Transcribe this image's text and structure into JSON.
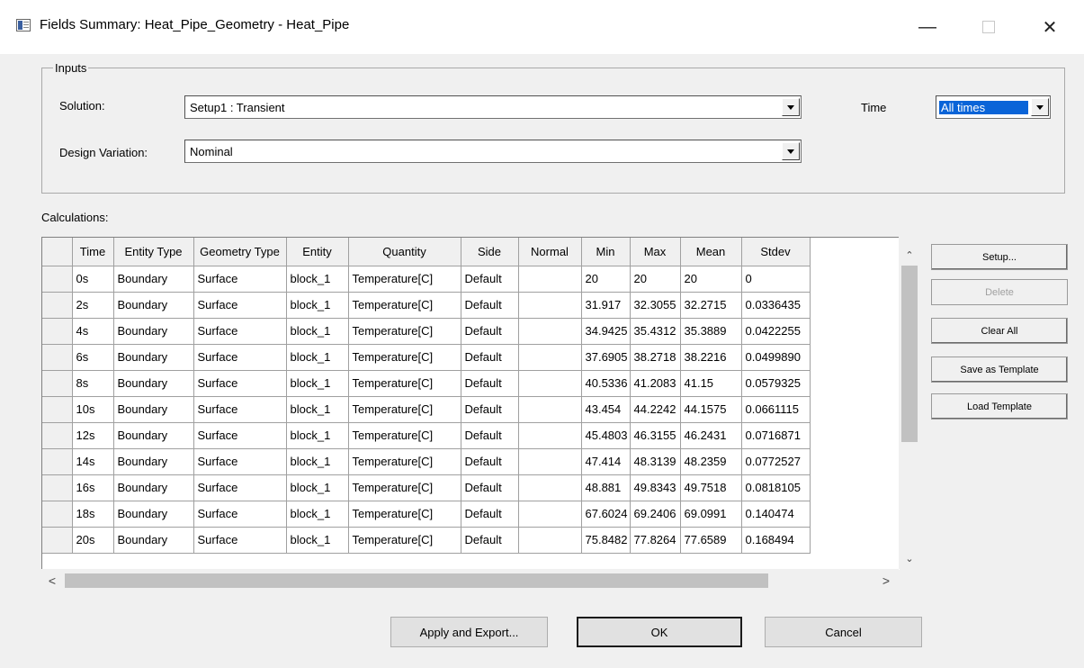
{
  "window": {
    "title": "Fields Summary: Heat_Pipe_Geometry - Heat_Pipe",
    "minimize_glyph": "—",
    "close_glyph": "✕"
  },
  "inputs": {
    "legend": "Inputs",
    "solution_label": "Solution:",
    "solution_value": "Setup1 : Transient",
    "design_variation_label": "Design Variation:",
    "design_variation_value": "Nominal",
    "time_label": "Time",
    "time_value": "All times"
  },
  "calculations": {
    "label": "Calculations:",
    "columns": [
      "Time",
      "Entity Type",
      "Geometry Type",
      "Entity",
      "Quantity",
      "Side",
      "Normal",
      "Min",
      "Max",
      "Mean",
      "Stdev"
    ],
    "rows": [
      [
        "0s",
        "Boundary",
        "Surface",
        "block_1",
        "Temperature[C]",
        "Default",
        "",
        "20",
        "20",
        "20",
        "0"
      ],
      [
        "2s",
        "Boundary",
        "Surface",
        "block_1",
        "Temperature[C]",
        "Default",
        "",
        "31.917",
        "32.3055",
        "32.2715",
        "0.0336435"
      ],
      [
        "4s",
        "Boundary",
        "Surface",
        "block_1",
        "Temperature[C]",
        "Default",
        "",
        "34.9425",
        "35.4312",
        "35.3889",
        "0.0422255"
      ],
      [
        "6s",
        "Boundary",
        "Surface",
        "block_1",
        "Temperature[C]",
        "Default",
        "",
        "37.6905",
        "38.2718",
        "38.2216",
        "0.0499890"
      ],
      [
        "8s",
        "Boundary",
        "Surface",
        "block_1",
        "Temperature[C]",
        "Default",
        "",
        "40.5336",
        "41.2083",
        "41.15",
        "0.0579325"
      ],
      [
        "10s",
        "Boundary",
        "Surface",
        "block_1",
        "Temperature[C]",
        "Default",
        "",
        "43.454",
        "44.2242",
        "44.1575",
        "0.0661115"
      ],
      [
        "12s",
        "Boundary",
        "Surface",
        "block_1",
        "Temperature[C]",
        "Default",
        "",
        "45.4803",
        "46.3155",
        "46.2431",
        "0.0716871"
      ],
      [
        "14s",
        "Boundary",
        "Surface",
        "block_1",
        "Temperature[C]",
        "Default",
        "",
        "47.414",
        "48.3139",
        "48.2359",
        "0.0772527"
      ],
      [
        "16s",
        "Boundary",
        "Surface",
        "block_1",
        "Temperature[C]",
        "Default",
        "",
        "48.881",
        "49.8343",
        "49.7518",
        "0.0818105"
      ],
      [
        "18s",
        "Boundary",
        "Surface",
        "block_1",
        "Temperature[C]",
        "Default",
        "",
        "67.6024",
        "69.2406",
        "69.0991",
        "0.140474"
      ],
      [
        "20s",
        "Boundary",
        "Surface",
        "block_1",
        "Temperature[C]",
        "Default",
        "",
        "75.8482",
        "77.8264",
        "77.6589",
        "0.168494"
      ]
    ]
  },
  "side_buttons": {
    "setup": "Setup...",
    "delete": "Delete",
    "clear_all": "Clear All",
    "save_template": "Save as Template",
    "load_template": "Load Template"
  },
  "footer": {
    "apply_export": "Apply and Export...",
    "ok": "OK",
    "cancel": "Cancel"
  },
  "scroll": {
    "up_glyph": "⌃",
    "down_glyph": "⌄",
    "left_glyph": "<",
    "right_glyph": ">"
  }
}
